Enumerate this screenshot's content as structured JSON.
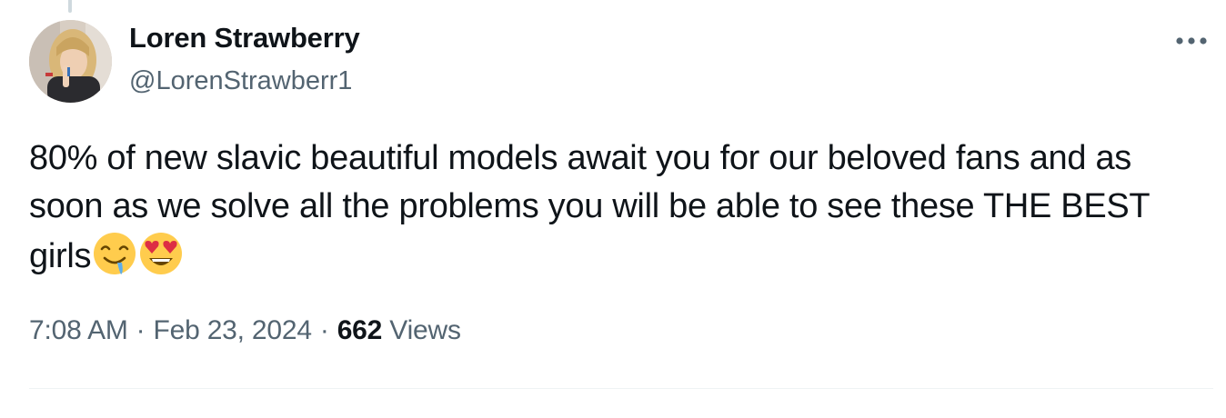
{
  "tweet": {
    "author": {
      "display_name": "Loren Strawberry",
      "handle": "@LorenStrawberr1"
    },
    "text": "80% of new slavic beautiful models await you for our beloved fans and as soon as we solve all the problems you will be able to see these THE BEST girls",
    "emojis": [
      "drooling-face",
      "smiling-face-with-heart-eyes"
    ],
    "timestamp": {
      "time": "7:08 AM",
      "separator": "·",
      "date": "Feb 23, 2024"
    },
    "views": {
      "count": "662",
      "label": "Views"
    }
  },
  "icons": {
    "more": "more-horizontal-icon"
  },
  "colors": {
    "text_primary": "#0f1419",
    "text_secondary": "#536471",
    "divider": "#eff3f4",
    "thread_line": "#cfd9de"
  }
}
